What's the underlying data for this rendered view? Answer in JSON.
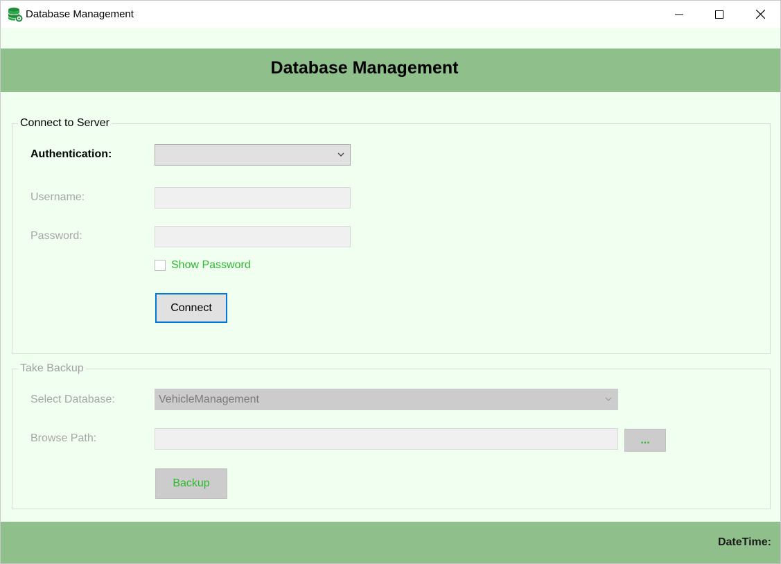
{
  "window": {
    "title": "Database Management",
    "app_icon": "database-gear-icon",
    "controls": [
      "minimize-icon",
      "maximize-icon",
      "close-icon"
    ]
  },
  "header": {
    "title": "Database Management",
    "background_color": "#8fbf8a"
  },
  "connect_group": {
    "legend": "Connect to Server",
    "authentication_label": "Authentication:",
    "authentication_value": "",
    "username_label": "Username:",
    "username_value": "",
    "password_label": "Password:",
    "password_value": "",
    "show_password_label": "Show Password",
    "show_password_checked": false,
    "connect_button": "Connect"
  },
  "backup_group": {
    "legend": "Take Backup",
    "select_database_label": "Select Database:",
    "select_database_value": "VehicleManagement",
    "browse_path_label": "Browse Path:",
    "browse_path_value": "",
    "browse_button": "...",
    "backup_button": "Backup"
  },
  "footer": {
    "datetime_label": "DateTime:"
  },
  "colors": {
    "accent_green": "#2eb82e",
    "focus_blue": "#0078d7",
    "form_background": "#f0fff0"
  }
}
